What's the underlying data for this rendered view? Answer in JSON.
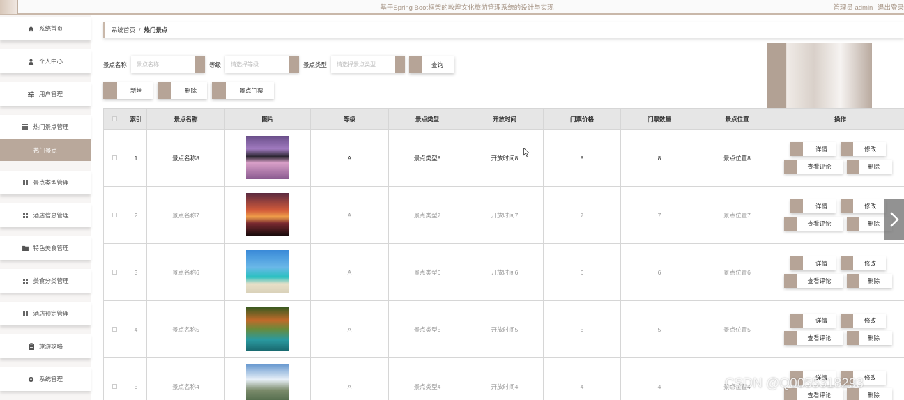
{
  "header": {
    "site_title": "基于Spring Boot框架的敦煌文化旅游管理系统的设计与实现",
    "user_label": "管理员 admin",
    "logout_label": "退出登录"
  },
  "sidebar": {
    "items": [
      {
        "label": "系统首页",
        "icon": "home-icon"
      },
      {
        "label": "个人中心",
        "icon": "user-icon"
      },
      {
        "label": "用户管理",
        "icon": "sliders-icon"
      },
      {
        "label": "热门景点管理",
        "icon": "grid-icon"
      },
      {
        "label": "热门景点",
        "icon": ""
      },
      {
        "label": "景点类型管理",
        "icon": "grid-icon"
      },
      {
        "label": "酒店信息管理",
        "icon": "grid-icon"
      },
      {
        "label": "特色美食管理",
        "icon": "folder-icon"
      },
      {
        "label": "美食分类管理",
        "icon": "grid-icon"
      },
      {
        "label": "酒店预定管理",
        "icon": "grid-icon"
      },
      {
        "label": "旅游攻略",
        "icon": "clipboard-icon"
      },
      {
        "label": "系统管理",
        "icon": "settings-icon"
      }
    ]
  },
  "breadcrumb": {
    "home": "系统首页",
    "separator": "/",
    "current": "热门景点"
  },
  "search": {
    "name_label": "景点名称",
    "name_placeholder": "景点名称",
    "level_label": "等级",
    "level_placeholder": "请选择等级",
    "type_label": "景点类型",
    "type_placeholder": "请选择景点类型",
    "query_button": "查询"
  },
  "actions": {
    "add": "新增",
    "delete": "删除",
    "tickets": "景点门票"
  },
  "table": {
    "columns": [
      "索引",
      "景点名称",
      "图片",
      "等级",
      "景点类型",
      "开放时间",
      "门票价格",
      "门票数量",
      "景点位置",
      "操作"
    ],
    "rows": [
      {
        "index": "1",
        "name": "景点名称8",
        "level": "A",
        "type": "景点类型8",
        "open_time": "开放时间8",
        "price": "8",
        "quantity": "8",
        "location": "景点位置8"
      },
      {
        "index": "2",
        "name": "景点名称7",
        "level": "A",
        "type": "景点类型7",
        "open_time": "开放时间7",
        "price": "7",
        "quantity": "7",
        "location": "景点位置7"
      },
      {
        "index": "3",
        "name": "景点名称6",
        "level": "A",
        "type": "景点类型6",
        "open_time": "开放时间6",
        "price": "6",
        "quantity": "6",
        "location": "景点位置6"
      },
      {
        "index": "4",
        "name": "景点名称5",
        "level": "A",
        "type": "景点类型5",
        "open_time": "开放时间5",
        "price": "5",
        "quantity": "5",
        "location": "景点位置5"
      },
      {
        "index": "5",
        "name": "景点名称4",
        "level": "A",
        "type": "景点类型4",
        "open_time": "开放时间4",
        "price": "4",
        "quantity": "4",
        "location": "景点位置4"
      }
    ],
    "row_actions": {
      "detail": "详情",
      "edit": "修改",
      "comments": "查看评论",
      "delete": "删除"
    }
  },
  "watermark": "CSDN @Q0055318293",
  "colors": {
    "accent": "#b6a497",
    "header_border": "#c9b8aa",
    "active_menu": "#b9a89b"
  }
}
